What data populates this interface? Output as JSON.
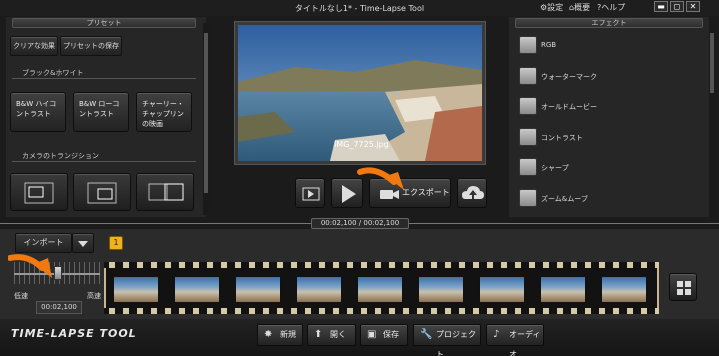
{
  "window": {
    "title": "タイトルなし1* - Time-Lapse Tool",
    "settings_label": "設定",
    "overview_label": "概要",
    "help_label": "ヘルプ",
    "minimize_symbol": "▬",
    "maximize_symbol": "◻",
    "close_symbol": "✕"
  },
  "presets": {
    "header": "プリセット",
    "clear_effects_label": "クリアな効果",
    "save_preset_label": "プリセットの保存",
    "bw_header": "ブラック&ホワイト",
    "bw_items": [
      {
        "label": "B&W ハイコントラスト"
      },
      {
        "label": "B&W ローコントラスト"
      },
      {
        "label": "チャーリー・チャップリンの映画"
      }
    ],
    "camera_header": "カメラのトランジション"
  },
  "preview": {
    "filename": "IMG_7725.jpg",
    "export_label": "エクスポート"
  },
  "effects": {
    "header": "エフェクト",
    "items": [
      {
        "label": "RGB"
      },
      {
        "label": "ウォーターマーク"
      },
      {
        "label": "オールドムービー"
      },
      {
        "label": "コントラスト"
      },
      {
        "label": "シャープ"
      },
      {
        "label": "ズーム&ムーブ"
      }
    ]
  },
  "timeline": {
    "time": "00:02,100  /  00:02,100",
    "import_label": "インポート",
    "frame_badge": "1",
    "speed_low": "低速",
    "speed_high": "高速",
    "speed_value": "00:02,100"
  },
  "footer": {
    "logo": "TIME-LAPSE TOOL",
    "new_label": "新規",
    "open_label": "開く",
    "save_label": "保存",
    "project_label": "プロジェクト",
    "audio_label": "オーディオ"
  },
  "colors": {
    "accent_orange": "#f07a10",
    "badge_yellow": "#f0b419"
  }
}
